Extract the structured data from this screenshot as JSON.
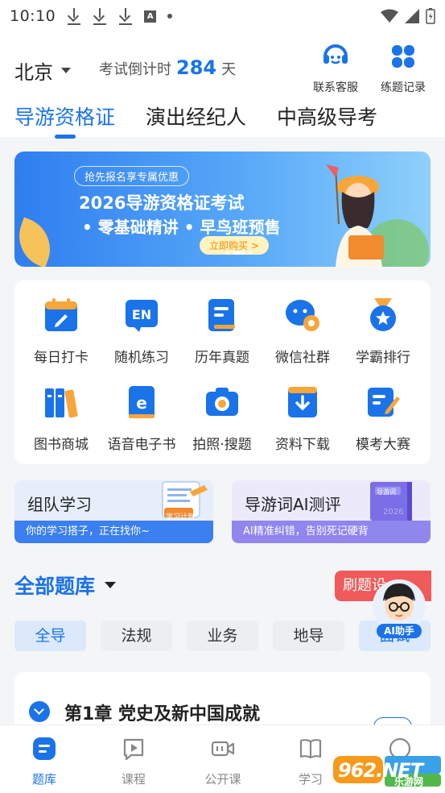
{
  "status_bar": {
    "time": "10:10",
    "a_badge": "A"
  },
  "header": {
    "city": "北京",
    "countdown_prefix": "考试倒计时",
    "countdown_days": "284",
    "countdown_suffix": "天",
    "service_label": "联系客服",
    "records_label": "练题记录"
  },
  "tabs": [
    {
      "label": "导游资格证"
    },
    {
      "label": "演出经纪人"
    },
    {
      "label": "中高级导考"
    }
  ],
  "banner": {
    "pill": "抢先报名享专属优惠",
    "line1": "2026导游资格证考试",
    "line2": "• 零基础精讲 • 早鸟班预售",
    "buy": "立即购买 >"
  },
  "grid": [
    {
      "label": "每日打卡",
      "icon": "calendar-pen-icon"
    },
    {
      "label": "随机练习",
      "icon": "en-icon"
    },
    {
      "label": "历年真题",
      "icon": "document-icon"
    },
    {
      "label": "微信社群",
      "icon": "wechat-icon"
    },
    {
      "label": "学霸排行",
      "icon": "medal-icon"
    },
    {
      "label": "图书商城",
      "icon": "books-icon"
    },
    {
      "label": "语音电子书",
      "icon": "ebook-icon"
    },
    {
      "label": "拍照·搜题",
      "icon": "camera-icon"
    },
    {
      "label": "资料下载",
      "icon": "download-icon"
    },
    {
      "label": "模考大赛",
      "icon": "exam-edit-icon"
    }
  ],
  "promos": [
    {
      "title": "组队学习",
      "subtitle": "你的学习搭子，正在找你~",
      "badge": "学习计划"
    },
    {
      "title": "导游词AI测评",
      "subtitle": "AI精准纠错，告别死记硬背",
      "book": "导游词",
      "book_tag": "2026"
    }
  ],
  "question_bank": {
    "title": "全部题库",
    "brush_label": "刷题设",
    "chips": [
      {
        "label": "全导"
      },
      {
        "label": "法规"
      },
      {
        "label": "业务"
      },
      {
        "label": "地导"
      },
      {
        "label": "面试"
      }
    ],
    "ai_label": "AI助手"
  },
  "chapter": {
    "title": "第1章 党史及新中国成就"
  },
  "bottom_nav": [
    {
      "label": "题库"
    },
    {
      "label": "课程"
    },
    {
      "label": "公开课"
    },
    {
      "label": "学习"
    }
  ],
  "watermark": {
    "brand": "962.NET",
    "sub": "乐游网"
  },
  "colors": {
    "accent": "#1a73e8",
    "brush": "#f05a5a",
    "banner": "#3b8cf3"
  }
}
